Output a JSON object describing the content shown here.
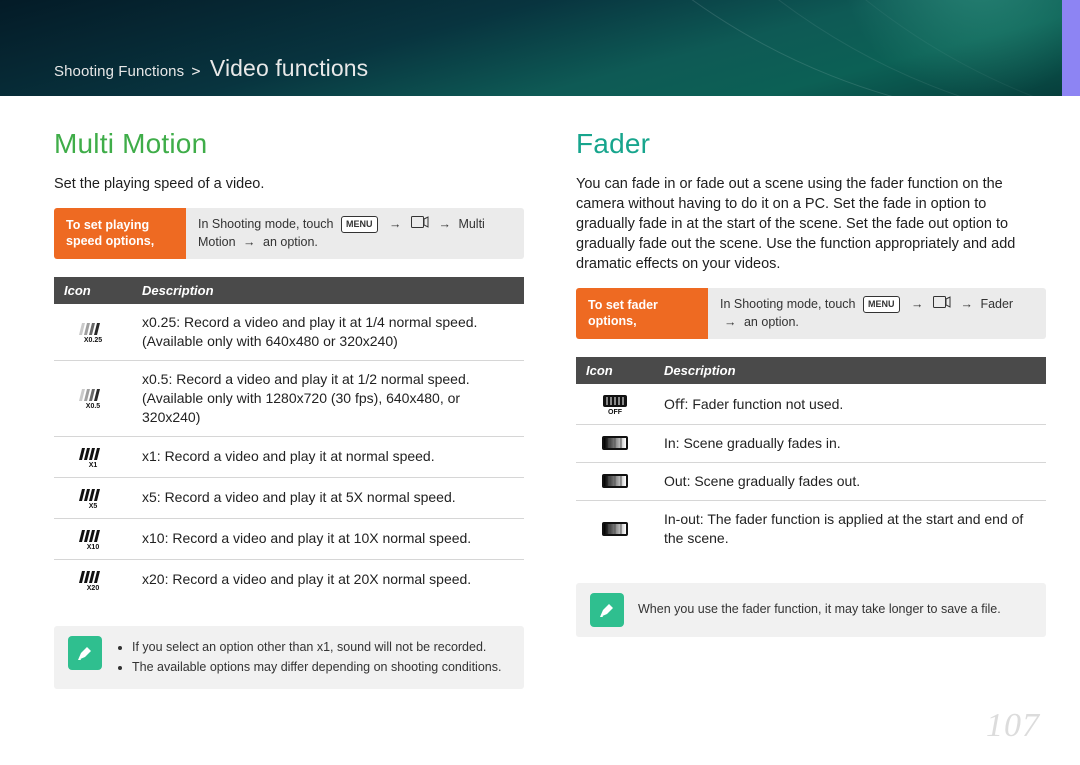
{
  "breadcrumb": {
    "parent": "Shooting Functions",
    "caret": ">",
    "title": "Video functions"
  },
  "page_number": "107",
  "left": {
    "heading": "Multi Motion",
    "intro": "Set the playing speed of a video.",
    "instr_label": "To set playing speed options,",
    "instr_prefix": "In Shooting mode, touch",
    "instr_menu": "MENU",
    "instr_tail": "Multi Motion",
    "instr_end": "an option.",
    "cols": {
      "icon": "Icon",
      "desc": "Description"
    },
    "rows": [
      {
        "icon_label": "x0.25",
        "desc": "x0.25: Record a video and play it at 1/4 normal speed. (Available only with 640x480 or 320x240)"
      },
      {
        "icon_label": "x0.5",
        "desc": "x0.5: Record a video and play it at 1/2 normal speed. (Available only with 1280x720 (30 fps), 640x480, or 320x240)"
      },
      {
        "icon_label": "x1",
        "desc": "x1: Record a video and play it at normal speed."
      },
      {
        "icon_label": "x5",
        "desc": "x5: Record a video and play it at 5X normal speed."
      },
      {
        "icon_label": "x10",
        "desc": "x10: Record a video and play it at 10X normal speed."
      },
      {
        "icon_label": "x20",
        "desc": "x20: Record a video and play it at 20X normal speed."
      }
    ],
    "notes": [
      "If you select an option other than x1, sound will not be recorded.",
      "The available options may differ depending on shooting conditions."
    ]
  },
  "right": {
    "heading": "Fader",
    "intro": "You can fade in or fade out a scene using the fader function on the camera without having to do it on a PC. Set the fade in option to gradually fade in at the start of the scene. Set the fade out option to gradually fade out the scene. Use the function appropriately and add dramatic effects on your videos.",
    "instr_label": "To set fader options,",
    "instr_prefix": "In Shooting mode, touch",
    "instr_menu": "MENU",
    "instr_tail": "Fader",
    "instr_end": "an option.",
    "cols": {
      "icon": "Icon",
      "desc": "Description"
    },
    "rows": [
      {
        "icon": "fader-off",
        "desc": "Oﬀ: Fader function not used."
      },
      {
        "icon": "fader-in",
        "desc": "In: Scene gradually fades in."
      },
      {
        "icon": "fader-out",
        "desc": "Out: Scene gradually fades out."
      },
      {
        "icon": "fader-inout",
        "desc": "In-out: The fader function is applied at the start and end of the scene."
      }
    ],
    "note": "When you use the fader function, it may take longer to save a file."
  }
}
